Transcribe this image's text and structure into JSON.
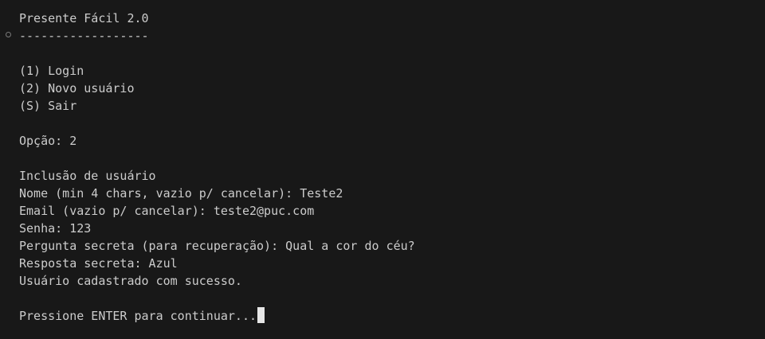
{
  "terminal": {
    "lines": [
      "Presente Fácil 2.0",
      "------------------",
      "",
      "(1) Login",
      "(2) Novo usuário",
      "(S) Sair",
      "",
      "Opção: 2",
      "",
      "Inclusão de usuário",
      "Nome (min 4 chars, vazio p/ cancelar): Teste2",
      "Email (vazio p/ cancelar): teste2@puc.com",
      "Senha: 123",
      "Pergunta secreta (para recuperação): Qual a cor do céu?",
      "Resposta secreta: Azul",
      "Usuário cadastrado com sucesso.",
      "",
      "Pressione ENTER para continuar..."
    ]
  }
}
